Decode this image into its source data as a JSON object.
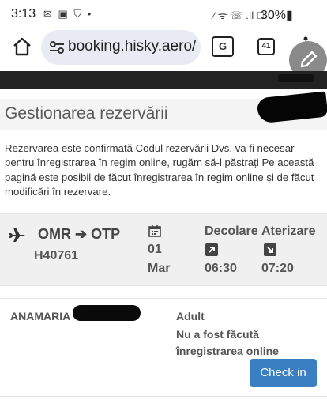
{
  "status_bar": {
    "time": "3:13",
    "left_icons": "✉ ▣ ⛉ •",
    "right_icons": "⁄ ᯤ ☏ .ıl ⃠",
    "battery": "30%▮"
  },
  "browser": {
    "url": "booking.hisky.aero/V",
    "tab_count": "41",
    "translate_label": "G"
  },
  "page": {
    "title": "Gestionarea rezervării",
    "info_text": "Rezervarea este confirmată Codul rezervării Dvs. va fi necesar pentru înregistrarea în regim online, rugăm să-l păstrați Pe această pagină este posibil de făcut înregistrarea în regim online și de făcut modificări în rezervare."
  },
  "flight": {
    "origin": "OMR",
    "destination": "OTP",
    "arrow": "➔",
    "number": "H40761",
    "date_day": "01",
    "date_month": "Mar",
    "departure_label": "Decolare",
    "arrival_label": "Aterizare",
    "departure_time": "06:30",
    "arrival_time": "07:20"
  },
  "passenger": {
    "name": "ANAMARIA",
    "type": "Adult",
    "checkin_status": "Nu a fost făcută înregistrarea online",
    "checkin_button": "Check in"
  },
  "colors": {
    "accent": "#3a7fc1",
    "dark_band": "#222222",
    "panel": "#f0f0f0"
  }
}
